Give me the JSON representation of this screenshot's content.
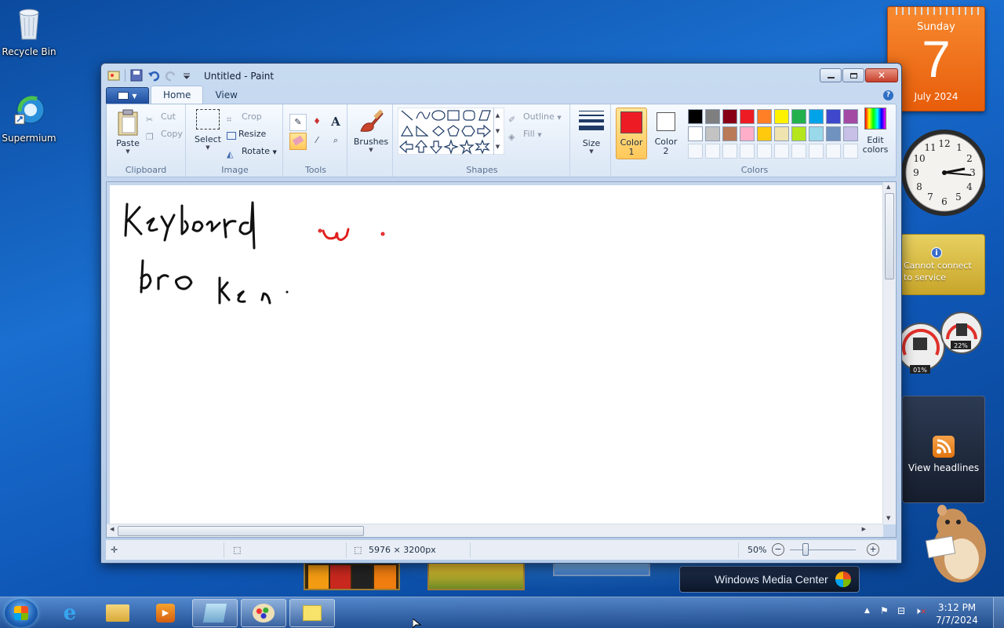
{
  "desktop": {
    "icons": [
      {
        "label": "Recycle Bin"
      },
      {
        "label": "Supermium"
      }
    ]
  },
  "gadgets": {
    "calendar": {
      "weekday": "Sunday",
      "day": "7",
      "month": "July 2024"
    },
    "clock": {
      "numerals": [
        "12",
        "1",
        "2",
        "3",
        "4",
        "5",
        "6",
        "7",
        "8",
        "9",
        "10",
        "11"
      ]
    },
    "weather": {
      "message": "Cannot connect to service"
    },
    "meter": {
      "cpu": "01%",
      "memory": "22%"
    },
    "feeds": {
      "label": "View headlines"
    }
  },
  "window": {
    "title": "Untitled - Paint",
    "tabs": [
      {
        "label": "Home"
      },
      {
        "label": "View"
      }
    ],
    "clipboard": {
      "group": "Clipboard",
      "paste": "Paste",
      "cut": "Cut",
      "copy": "Copy"
    },
    "image": {
      "group": "Image",
      "select": "Select",
      "crop": "Crop",
      "resize": "Resize",
      "rotate": "Rotate"
    },
    "tools": {
      "group": "Tools"
    },
    "brushes": {
      "label": "Brushes"
    },
    "shapes": {
      "group": "Shapes",
      "outline": "Outline",
      "fill": "Fill"
    },
    "size": {
      "label": "Size"
    },
    "colors": {
      "group": "Colors",
      "color1": "Color 1",
      "color2": "Color 2",
      "edit": "Edit colors",
      "color1_value": "#ed1c24",
      "color2_value": "#ffffff",
      "row1": [
        "#000000",
        "#7f7f7f",
        "#880015",
        "#ed1c24",
        "#ff7f27",
        "#fff200",
        "#22b14c",
        "#00a2e8",
        "#3f48cc",
        "#a349a4"
      ],
      "row2": [
        "#ffffff",
        "#c3c3c3",
        "#b97a57",
        "#ffaec9",
        "#ffc90e",
        "#efe4b0",
        "#b5e61d",
        "#99d9ea",
        "#7092be",
        "#c8bfe7"
      ]
    },
    "canvas": {
      "line1": "keyboard",
      "line2": "broken"
    },
    "status": {
      "dimensions": "5976 × 3200px",
      "zoom": "50%"
    }
  },
  "background_tiles": {
    "wmc": "Windows Media Center"
  },
  "taskbar": {
    "time": "3:12 PM",
    "date": "7/7/2024"
  }
}
